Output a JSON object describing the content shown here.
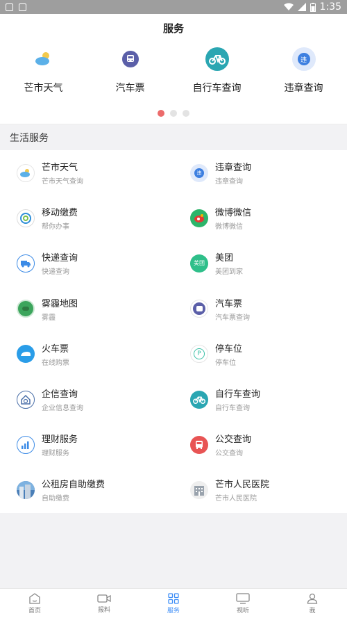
{
  "status_bar": {
    "time": "1:35"
  },
  "header": {
    "title": "服务"
  },
  "carousel": {
    "items": [
      {
        "label": "芒市天气",
        "icon": "weather-icon"
      },
      {
        "label": "汽车票",
        "icon": "bus-icon"
      },
      {
        "label": "自行车查询",
        "icon": "bicycle-icon"
      },
      {
        "label": "违章查询",
        "icon": "violation-icon"
      }
    ],
    "page_count": 3,
    "active_page": 1
  },
  "section": {
    "title": "生活服务"
  },
  "services": [
    {
      "title": "芒市天气",
      "subtitle": "芒市天气查询",
      "icon": "weather-icon",
      "color": "#4aa6e0"
    },
    {
      "title": "违章查询",
      "subtitle": "违章查询",
      "icon": "violation-icon",
      "color": "#3d7fe0"
    },
    {
      "title": "移动缴费",
      "subtitle": "帮你办事",
      "icon": "china-mobile-icon",
      "color": "#2f8fd8"
    },
    {
      "title": "微博微信",
      "subtitle": "微博微信",
      "icon": "weibo-wechat-icon",
      "color": "#2cb56a"
    },
    {
      "title": "快递查询",
      "subtitle": "快递查询",
      "icon": "delivery-truck-icon",
      "color": "#3c8be6"
    },
    {
      "title": "美团",
      "subtitle": "美团到家",
      "icon": "meituan-icon",
      "color": "#2fbf8a"
    },
    {
      "title": "雾霾地图",
      "subtitle": "雾霾",
      "icon": "smog-map-icon",
      "color": "#3ca55c"
    },
    {
      "title": "汽车票",
      "subtitle": "汽车票查询",
      "icon": "bus-icon",
      "color": "#5b5fa8"
    },
    {
      "title": "火车票",
      "subtitle": "在线购票",
      "icon": "train-icon",
      "color": "#2a9de8"
    },
    {
      "title": "停车位",
      "subtitle": "停车位",
      "icon": "parking-icon",
      "color": "#3cc0a8"
    },
    {
      "title": "企信查询",
      "subtitle": "企业信息查询",
      "icon": "enterprise-icon",
      "color": "#4a6fa8"
    },
    {
      "title": "自行车查询",
      "subtitle": "自行车查询",
      "icon": "bicycle-icon",
      "color": "#2aa6b2"
    },
    {
      "title": "理财服务",
      "subtitle": "理财服务",
      "icon": "finance-chart-icon",
      "color": "#3c8be6"
    },
    {
      "title": "公交查询",
      "subtitle": "公交查询",
      "icon": "bus-front-icon",
      "color": "#e85454"
    },
    {
      "title": "公租房自助缴费",
      "subtitle": "自助缴费",
      "icon": "public-housing-icon",
      "color": "#4a7fb8"
    },
    {
      "title": "芒市人民医院",
      "subtitle": "芒市人民医院",
      "icon": "hospital-icon",
      "color": "#8a8a8a"
    }
  ],
  "tabbar": {
    "tabs": [
      {
        "label": "首页",
        "icon": "home-icon"
      },
      {
        "label": "报料",
        "icon": "video-camera-icon"
      },
      {
        "label": "服务",
        "icon": "grid-icon"
      },
      {
        "label": "视听",
        "icon": "tv-icon"
      },
      {
        "label": "我",
        "icon": "person-icon"
      }
    ],
    "active_index": 2,
    "active_color": "#3e8ef7"
  }
}
